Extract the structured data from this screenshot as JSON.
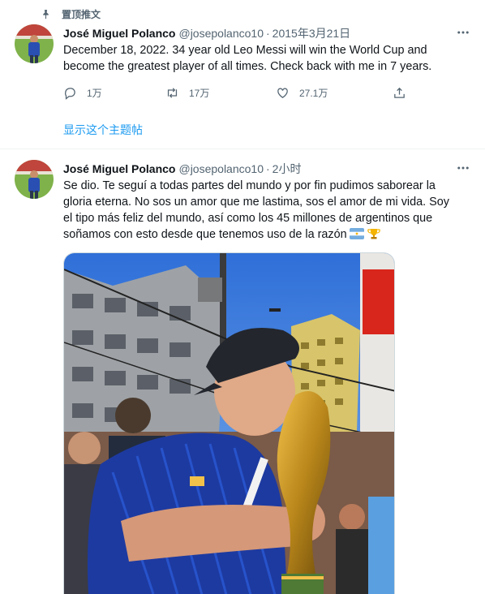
{
  "pinned": {
    "label": "置顶推文"
  },
  "tweets": [
    {
      "author": "José Miguel Polanco",
      "handle": "@josepolanco10",
      "separator": "·",
      "time": "2015年3月21日",
      "text": "December 18, 2022. 34 year old Leo Messi will win the World Cup and become the greatest player of all times. Check back with me in 7 years.",
      "actions": {
        "replies": "1万",
        "retweets": "17万",
        "likes": "27.1万"
      },
      "show_thread": "显示这个主题帖"
    },
    {
      "author": "José Miguel Polanco",
      "handle": "@josepolanco10",
      "separator": "·",
      "time": "2小时",
      "text": "Se dio. Te seguí a todas partes del mundo y por fin pudimos saborear la gloria eterna. No sos un amor que me lastima, sos el amor de mi vida. Soy el tipo más feliz del mundo, así como los 45 millones de argentinos que soñamos con esto desde que tenemos uso de la razón",
      "emoji": [
        "argentina-flag-icon",
        "trophy-icon"
      ]
    }
  ],
  "colors": {
    "accent": "#1d9bf0",
    "secondary_text": "#536471",
    "divider": "#eff3f4"
  }
}
